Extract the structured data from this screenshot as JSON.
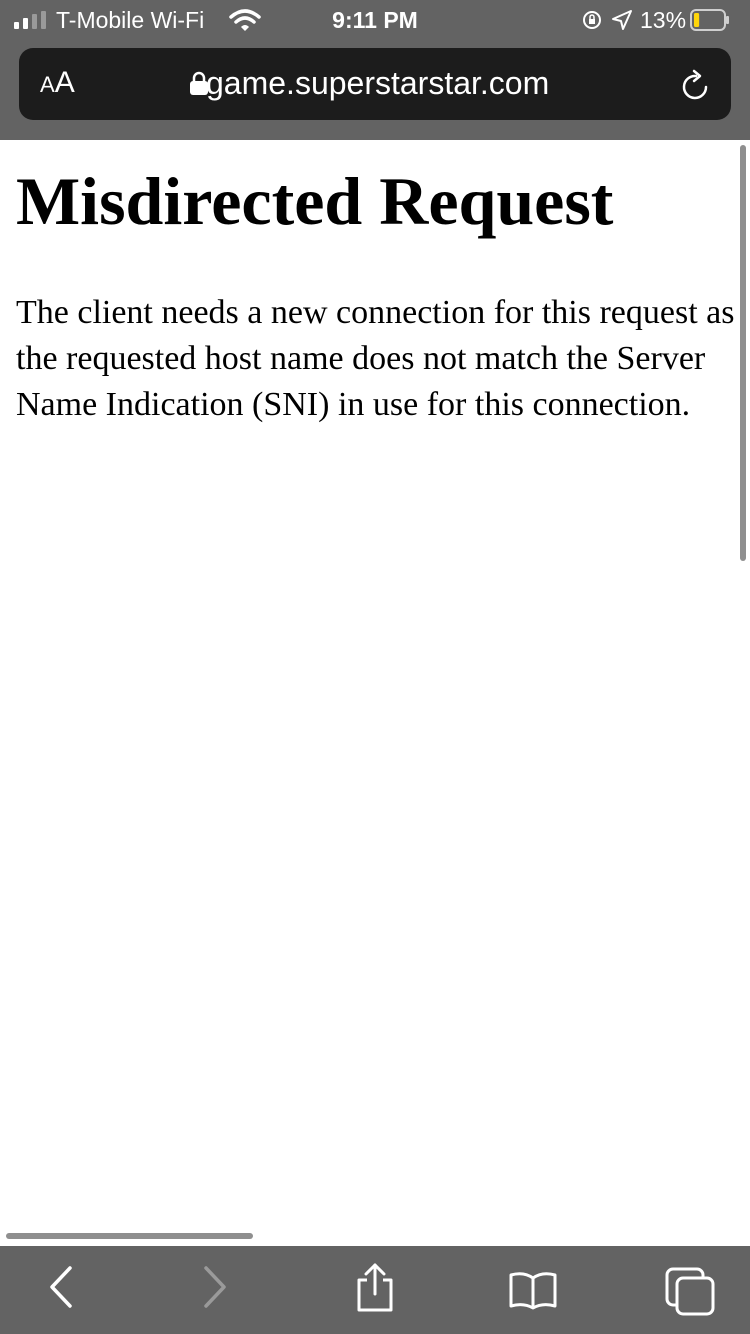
{
  "status_bar": {
    "carrier": "T-Mobile Wi-Fi",
    "time": "9:11 PM",
    "battery_percent": "13%",
    "battery_level": 0.13,
    "icons": [
      "signal-icon",
      "wifi-icon",
      "orientation-lock-icon",
      "location-icon",
      "battery-icon"
    ]
  },
  "url_bar": {
    "text_size_button": {
      "small": "A",
      "large": "A"
    },
    "url": "game.superstarstar.com",
    "icons": [
      "lock-icon",
      "reload-icon"
    ]
  },
  "page": {
    "title": "Misdirected Request",
    "message": "The client needs a new connection for this request as the requested host name does not match the Server Name Indication (SNI) in use for this connection."
  },
  "toolbar": {
    "icons": [
      "back-icon",
      "forward-icon",
      "share-icon",
      "bookmarks-icon",
      "tabs-icon"
    ]
  }
}
